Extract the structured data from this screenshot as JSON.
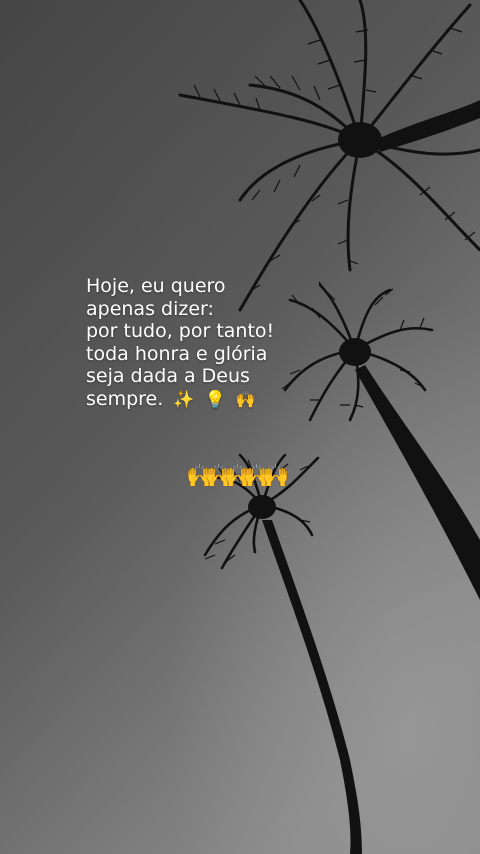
{
  "caption": {
    "lines": [
      "Hoje, eu quero",
      "apenas dizer:",
      "por tudo, por tanto!",
      "toda honra e glória",
      "seja dada a Deus",
      "sempre."
    ],
    "trailing_emojis": [
      "✨",
      "💡",
      "🙌"
    ]
  },
  "emoji_row": [
    "🙌",
    "🙌",
    "🙌",
    "🙌",
    "🙌"
  ],
  "icons": {
    "sparkles": "sparkles-icon",
    "bulb": "light-bulb-icon",
    "hands": "raised-hands-icon"
  },
  "colors": {
    "sky_top": "#4a4a4a",
    "sky_bottom": "#8c8c8c",
    "palm": "#111111",
    "text": "#ffffff",
    "hands": "#f2b233"
  }
}
